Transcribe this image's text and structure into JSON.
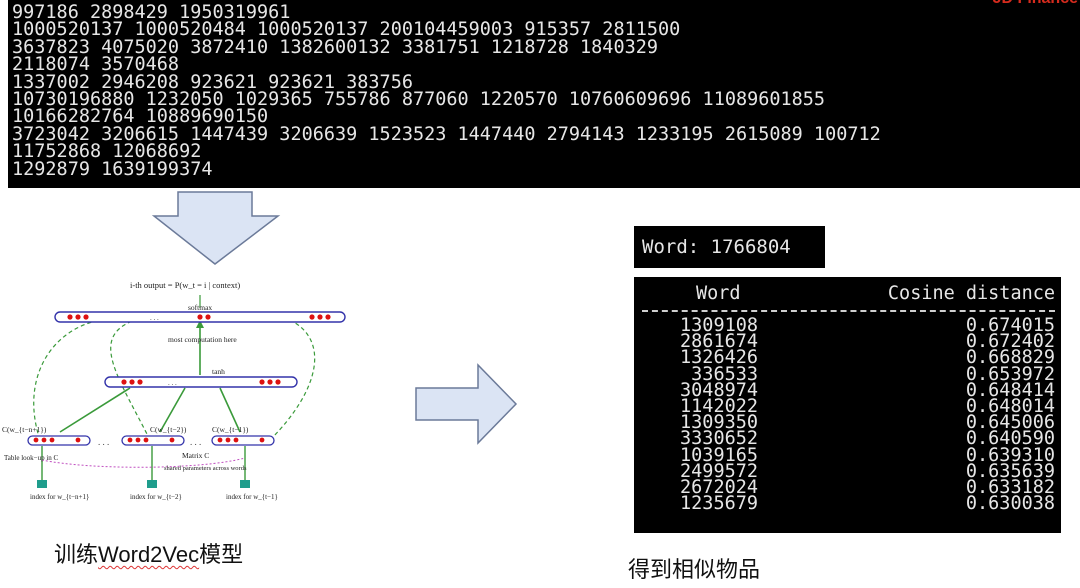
{
  "brand_fragment": "JD Finance",
  "sequences": [
    "997186 2898429 1950319961",
    "1000520137 1000520484 1000520137 200104459003 915357 2811500",
    "3637823 4075020 3872410 1382600132 3381751 1218728 1840329",
    "2118074 3570468",
    "1337002 2946208 923621 923621 383756",
    "10730196880 1232050 1029365 755786 877060 1220570 10760609696 11089601855",
    "10166282764 10889690150",
    "3723042 3206615 1447439 3206639 1523523 1447440 2794143 1233195 2615089 100712",
    "11752868 12068692",
    "1292879 1639199374"
  ],
  "query": {
    "label": "Word:",
    "value": "1766804"
  },
  "result_table": {
    "headers": [
      "Word",
      "Cosine distance"
    ],
    "rows": [
      [
        "1309108",
        "0.674015"
      ],
      [
        "2861674",
        "0.672402"
      ],
      [
        "1326426",
        "0.668829"
      ],
      [
        "336533",
        "0.653972"
      ],
      [
        "3048974",
        "0.648414"
      ],
      [
        "1142022",
        "0.648014"
      ],
      [
        "1309350",
        "0.645006"
      ],
      [
        "3330652",
        "0.640590"
      ],
      [
        "1039165",
        "0.639310"
      ],
      [
        "2499572",
        "0.635639"
      ],
      [
        "2672024",
        "0.633182"
      ],
      [
        "1235679",
        "0.630038"
      ]
    ]
  },
  "captions": {
    "train_prefix": "训练",
    "train_word": "Word2Vec",
    "train_suffix": "模型",
    "similar": "得到相似物品"
  },
  "nnlm_diagram": {
    "output": "i-th output = P(w_t = i | context)",
    "softmax": "softmax",
    "most_computation": "most computation here",
    "tanh": "tanh",
    "c1": "C(w_{t−n+1})",
    "c2": "C(w_{t−2})",
    "c3": "C(w_{t−1})",
    "table_lookup": "Table look−up in C",
    "matrix_c": "Matrix C",
    "shared_params": "shared parameters across words",
    "idx1": "index for w_{t−n+1}",
    "idx2": "index for w_{t−2}",
    "idx3": "index for w_{t−1}",
    "colors": {
      "layer_border": "#3333aa",
      "node": "#dd1111",
      "arrow_fill": "#dbe4f4",
      "arrow_stroke": "#6b7a99",
      "green": "#3a9a3a",
      "teal": "#1f9d8c",
      "magenta": "#c04fc0"
    }
  }
}
